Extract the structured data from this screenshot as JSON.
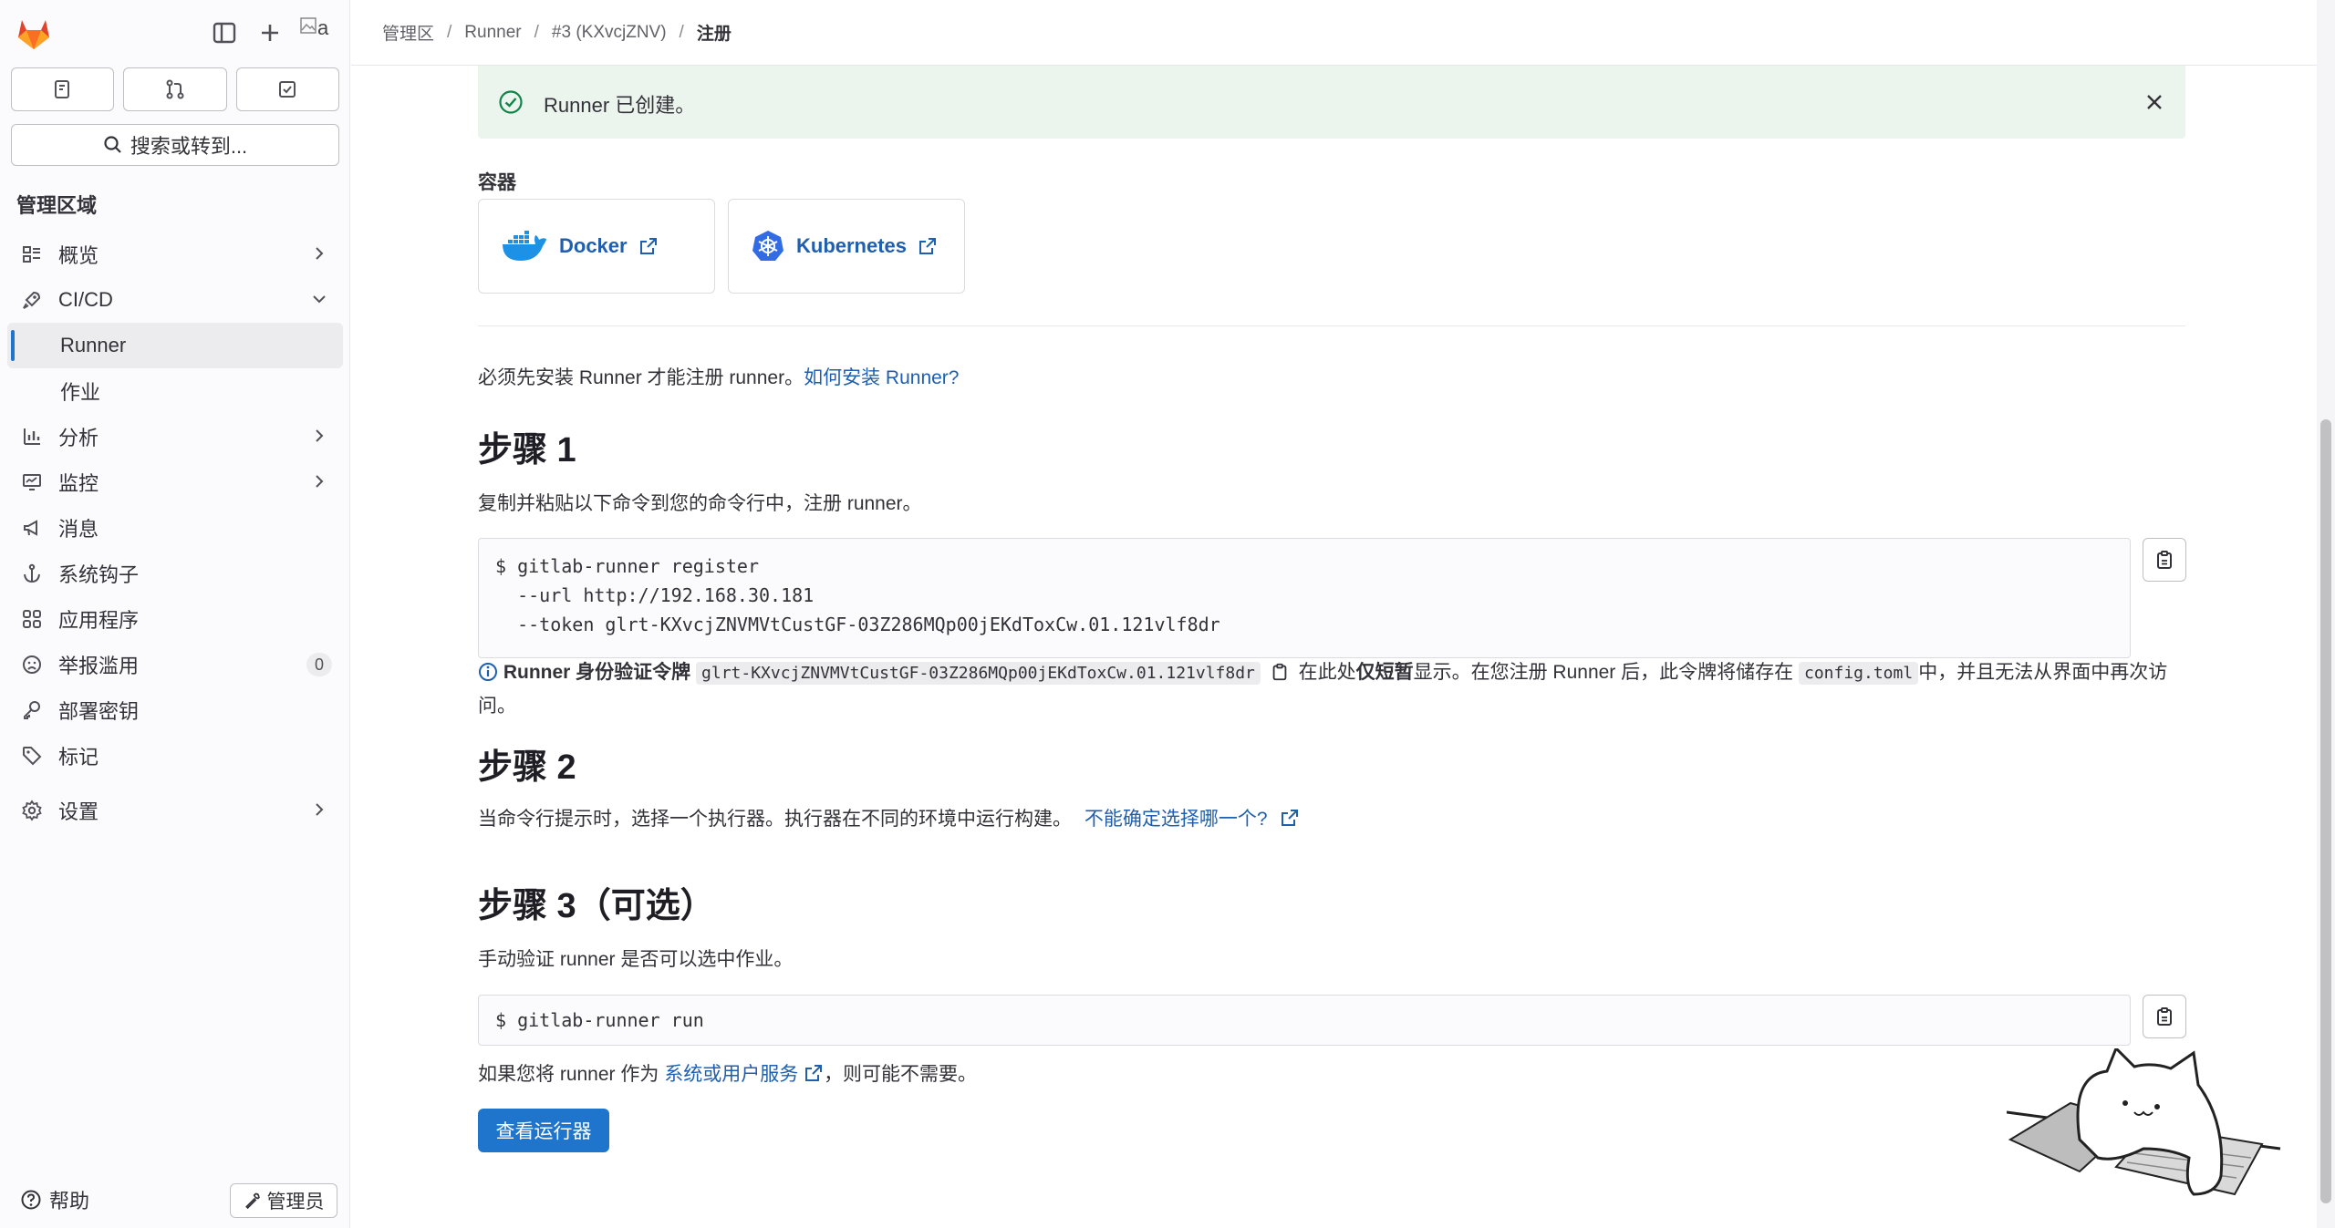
{
  "sidebar": {
    "search_label": "搜索或转到...",
    "area_title": "管理区域",
    "avatar_alt": "a",
    "items": [
      {
        "label": "概览"
      },
      {
        "label": "CI/CD"
      },
      {
        "label": "Runner"
      },
      {
        "label": "作业"
      },
      {
        "label": "分析"
      },
      {
        "label": "监控"
      },
      {
        "label": "消息"
      },
      {
        "label": "系统钩子"
      },
      {
        "label": "应用程序"
      },
      {
        "label": "举报滥用",
        "badge": "0"
      },
      {
        "label": "部署密钥"
      },
      {
        "label": "标记"
      },
      {
        "label": "设置"
      }
    ],
    "help_label": "帮助",
    "admin_label": "管理员"
  },
  "breadcrumb": [
    "管理区",
    "Runner",
    "#3 (KXvcjZNV)",
    "注册"
  ],
  "alert": {
    "text": "Runner 已创建。"
  },
  "containers": {
    "heading": "容器",
    "docker": "Docker",
    "kubernetes": "Kubernetes"
  },
  "intro": {
    "text": "必须先安装 Runner 才能注册 runner。",
    "link": "如何安装 Runner?"
  },
  "step1": {
    "title": "步骤 1",
    "desc": "复制并粘贴以下命令到您的命令行中，注册 runner。",
    "code": "$ gitlab-runner register\n  --url http://192.168.30.181\n  --token glrt-KXvcjZNVMVtCustGF-03Z286MQp00jEKdToxCw.01.121vlf8dr",
    "token_label": "Runner 身份验证令牌",
    "token": "glrt-KXvcjZNVMVtCustGF-03Z286MQp00jEKdToxCw.01.121vlf8dr",
    "note_pre": "在此处",
    "note_bold": "仅短暂",
    "note_mid": "显示。在您注册 Runner 后，此令牌将储存在",
    "config_file": "config.toml",
    "note_post": "中，并且无法从界面中再次访问。"
  },
  "step2": {
    "title": "步骤 2",
    "desc": "当命令行提示时，选择一个执行器。执行器在不同的环境中运行构建。",
    "link": "不能确定选择哪一个?"
  },
  "step3": {
    "title": "步骤 3（可选）",
    "desc": "手动验证 runner 是否可以选中作业。",
    "code": "$ gitlab-runner run",
    "note_pre": "如果您将 runner 作为",
    "note_link": "系统或用户服务",
    "note_post": "，则可能不需要。"
  },
  "view_runners_button": "查看运行器",
  "colors": {
    "accent": "#1f75cb",
    "link": "#1f5fad",
    "success_bg": "#ecf4ee",
    "success": "#108548"
  }
}
